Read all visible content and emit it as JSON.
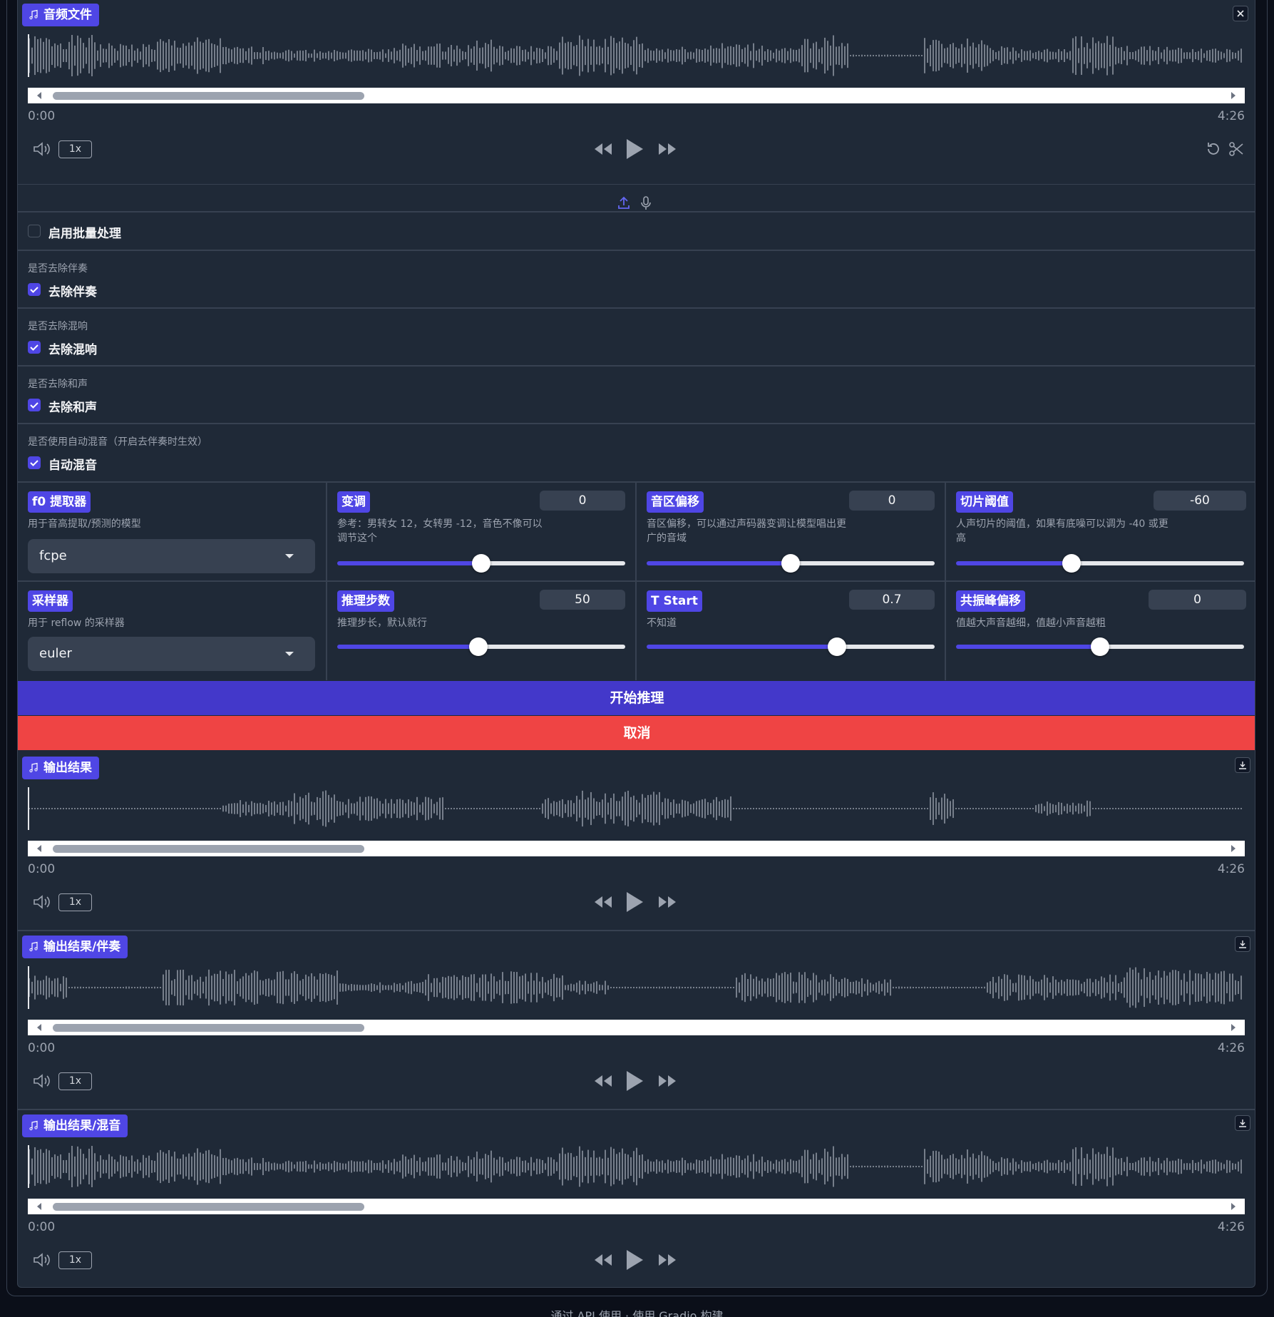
{
  "input_audio": {
    "label": "音频文件",
    "time_start": "0:00",
    "time_end": "4:26",
    "speed": "1x"
  },
  "batch": {
    "label": "启用批量处理",
    "checked": false
  },
  "toggles": [
    {
      "title": "是否去除伴奏",
      "label": "去除伴奏",
      "checked": true
    },
    {
      "title": "是否去除混响",
      "label": "去除混响",
      "checked": true
    },
    {
      "title": "是否去除和声",
      "label": "去除和声",
      "checked": true
    },
    {
      "title": "是否使用自动混音（开启去伴奏时生效）",
      "label": "自动混音",
      "checked": true
    }
  ],
  "params": {
    "f0": {
      "label": "f0 提取器",
      "info": "用于音高提取/预测的模型",
      "value": "fcpe"
    },
    "pitch": {
      "label": "变调",
      "info": "参考：男转女 12，女转男 -12，音色不像可以调节这个",
      "value": "0",
      "fraction": 0.5
    },
    "formant": {
      "label": "音区偏移",
      "info": "音区偏移，可以通过声码器变调让模型唱出更广的音域",
      "value": "0",
      "fraction": 0.5
    },
    "threshold": {
      "label": "切片阈值",
      "info": "人声切片的阈值，如果有底噪可以调为 -40 或更高",
      "value": "-60",
      "fraction": 0.4
    },
    "sampler": {
      "label": "采样器",
      "info": "用于 reflow 的采样器",
      "value": "euler"
    },
    "steps": {
      "label": "推理步数",
      "info": "推理步长，默认就行",
      "value": "50",
      "fraction": 0.49
    },
    "tstart": {
      "label": "T Start",
      "info": "不知道",
      "value": "0.7",
      "fraction": 0.66
    },
    "resonance": {
      "label": "共振峰偏移",
      "info": "值越大声音越细，值越小声音越粗",
      "value": "0",
      "fraction": 0.5
    }
  },
  "buttons": {
    "start": "开始推理",
    "cancel": "取消"
  },
  "outputs": [
    {
      "label": "输出结果",
      "time_start": "0:00",
      "time_end": "4:26",
      "speed": "1x"
    },
    {
      "label": "输出结果/伴奏",
      "time_start": "0:00",
      "time_end": "4:26",
      "speed": "1x"
    },
    {
      "label": "输出结果/混音",
      "time_start": "0:00",
      "time_end": "4:26",
      "speed": "1x"
    }
  ],
  "footer": "通过 API 使用 · 使用 Gradio 构建",
  "colors": {
    "accent": "#4f46e5",
    "danger": "#ef4444",
    "panel": "#1f2937",
    "background": "#0b0f19"
  }
}
